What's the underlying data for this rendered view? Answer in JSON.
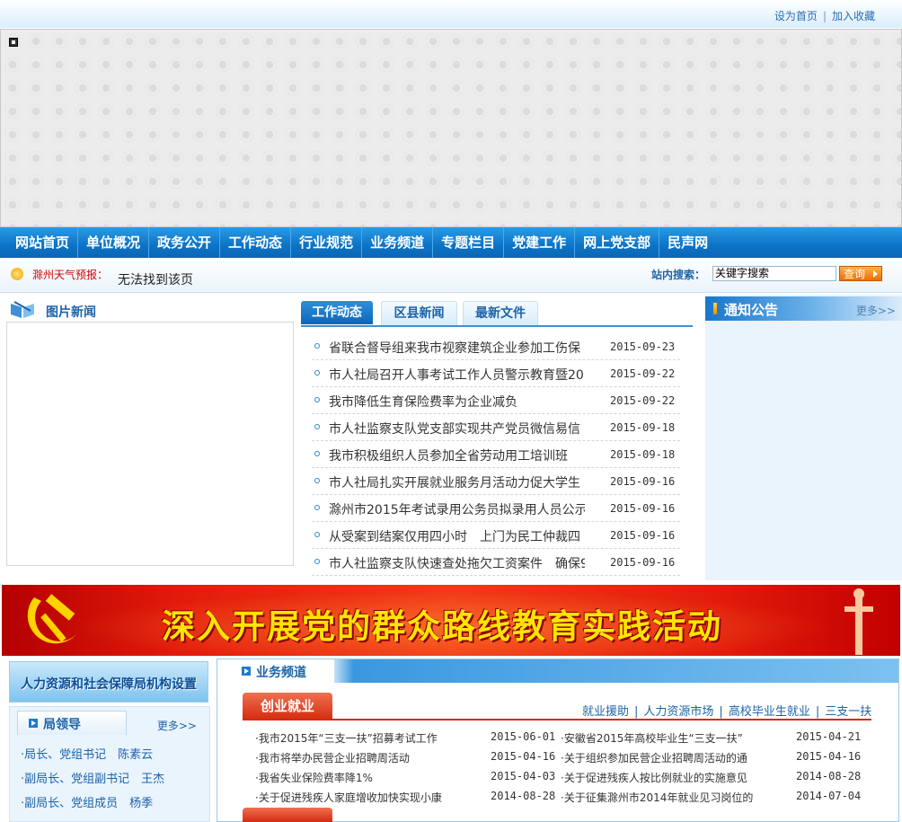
{
  "top": {
    "links": [
      "设为首页",
      "加入收藏"
    ]
  },
  "nav": [
    "网站首页",
    "单位概况",
    "政务公开",
    "工作动态",
    "行业规范",
    "业务频道",
    "专题栏目",
    "党建工作",
    "网上党支部",
    "民声网"
  ],
  "weather": {
    "label": "滁州天气预报：",
    "text": "无法找到该页"
  },
  "search": {
    "label": "站内搜索：",
    "value": "关键字搜索",
    "button": "查询"
  },
  "picture_news": {
    "title": "图片新闻"
  },
  "tabs": [
    "工作动态",
    "区县新闻",
    "最新文件"
  ],
  "news": [
    {
      "title": "省联合督导组来我市视察建筑企业参加工伤保",
      "date": "2015-09-23"
    },
    {
      "title": "市人社局召开人事考试工作人员警示教育暨20",
      "date": "2015-09-22"
    },
    {
      "title": "我市降低生育保险费率为企业减负",
      "date": "2015-09-22"
    },
    {
      "title": "市人社监察支队党支部实现共产党员微信易信",
      "date": "2015-09-18"
    },
    {
      "title": "我市积极组织人员参加全省劳动用工培训班",
      "date": "2015-09-18"
    },
    {
      "title": "市人社局扎实开展就业服务月活动力促大学生",
      "date": "2015-09-16"
    },
    {
      "title": "滁州市2015年考试录用公务员拟录用人员公示",
      "date": "2015-09-16"
    },
    {
      "title": "从受案到结案仅用四小时　上门为民工仲裁四",
      "date": "2015-09-16"
    },
    {
      "title": "市人社监察支队快速查处拖欠工资案件　确保9",
      "date": "2015-09-16"
    }
  ],
  "notice": {
    "title": "通知公告",
    "more": "更多>>"
  },
  "party_banner": {
    "text": "深入开展党的群众路线教育实践活动"
  },
  "org": {
    "text": "人力资源和社会保障局机构设置"
  },
  "leaders": {
    "title": "局领导",
    "more": "更多>>",
    "items": [
      "·局长、党组书记　陈素云",
      "·副局长、党组副书记　王杰",
      "·副局长、党组成员　杨季"
    ]
  },
  "business": {
    "title": "业务频道",
    "tab": "创业就业",
    "links": [
      "就业援助",
      "人力资源市场",
      "高校毕业生就业",
      "三支一扶"
    ],
    "left": [
      {
        "title": "·我市2015年“三支一扶”招募考试工作",
        "date": "2015-06-01"
      },
      {
        "title": "·我市将举办民营企业招聘周活动",
        "date": "2015-04-16"
      },
      {
        "title": "·我省失业保险费率降1%",
        "date": "2015-04-03"
      },
      {
        "title": "·关于促进残疾人家庭增收加快实现小康",
        "date": "2014-08-28"
      }
    ],
    "right": [
      {
        "title": "·安徽省2015年高校毕业生“三支一扶”",
        "date": "2015-04-21"
      },
      {
        "title": "·关于组织参加民营企业招聘周活动的通",
        "date": "2015-04-16"
      },
      {
        "title": "·关于促进残疾人按比例就业的实施意见",
        "date": "2014-08-28"
      },
      {
        "title": "·关于征集滁州市2014年就业见习岗位的",
        "date": "2014-07-04"
      }
    ]
  },
  "colors": {
    "nav": "#0c73c6",
    "accent_red": "#d42c10",
    "link": "#1d63a8",
    "banner_text": "#ffe400"
  }
}
